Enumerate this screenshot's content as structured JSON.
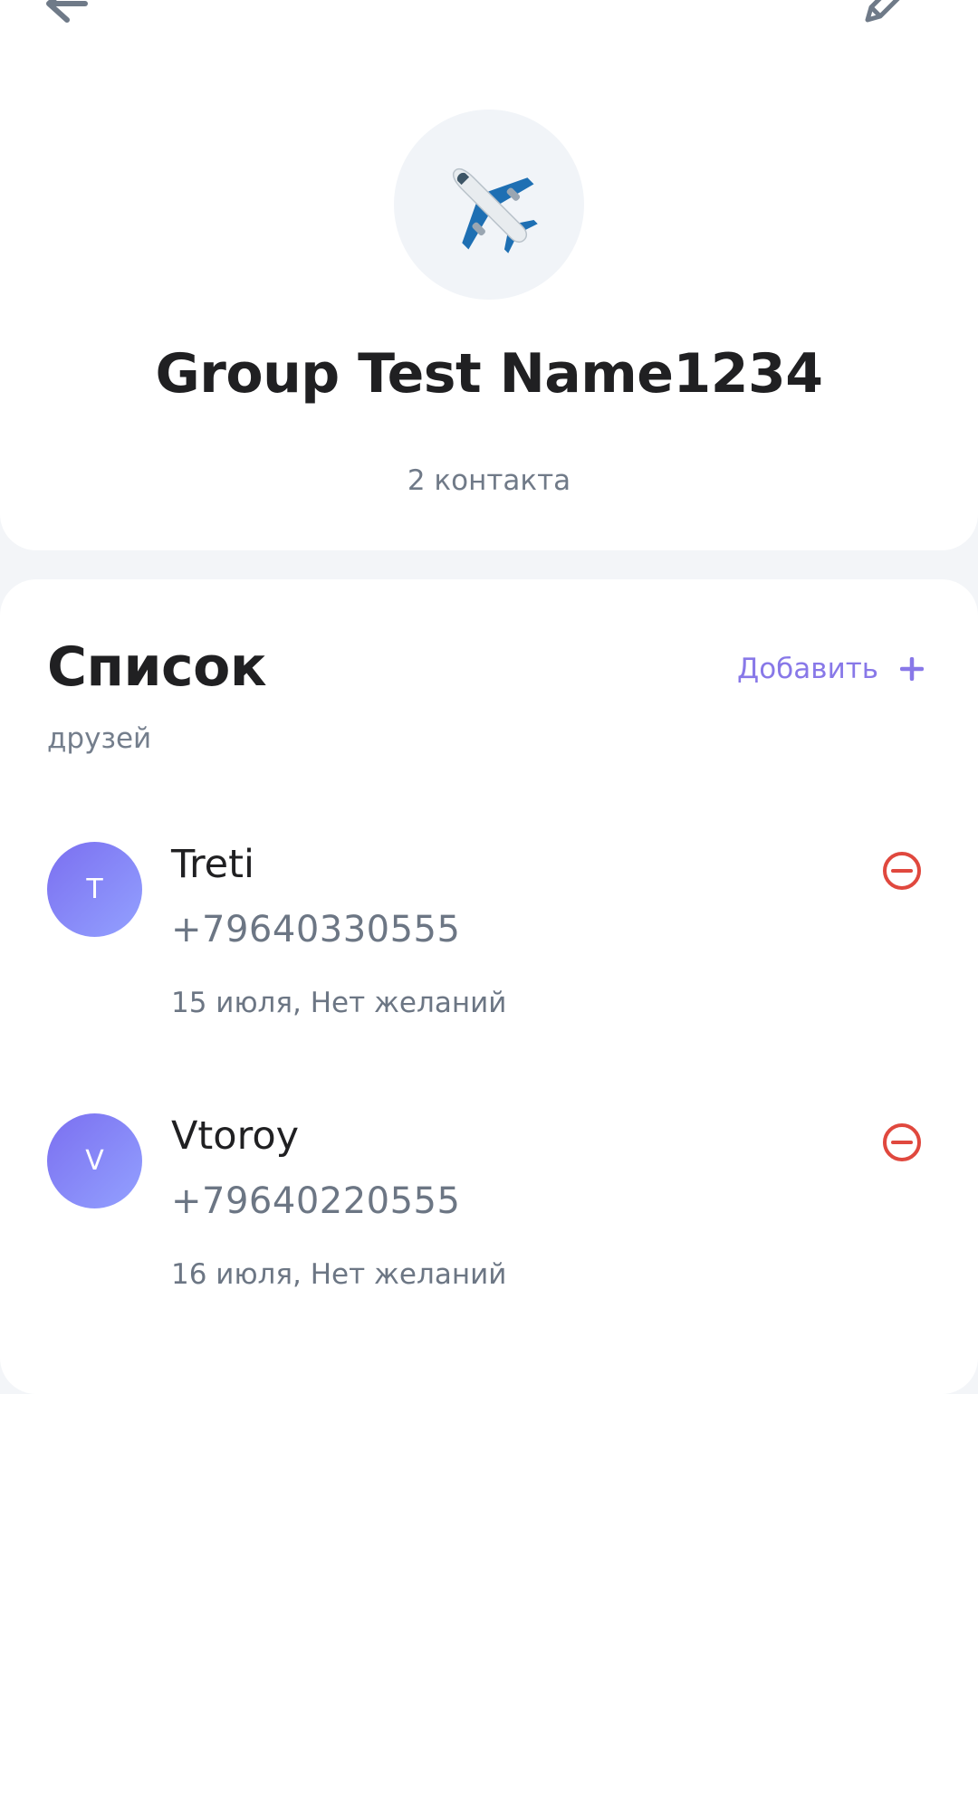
{
  "header": {
    "back_icon": "arrow-left-icon",
    "edit_icon": "pencil-icon",
    "avatar_icon": "airplane-icon",
    "group_name": "Group Test Name1234",
    "contacts_count": "2 контакта"
  },
  "list": {
    "title": "Список",
    "subtitle": "друзей",
    "add_label": "Добавить",
    "add_icon": "plus-icon",
    "contacts": [
      {
        "initial": "T",
        "name": "Treti",
        "phone": "+79640330555",
        "meta": "15 июля, Нет желаний",
        "remove_icon": "minus-circle-icon"
      },
      {
        "initial": "V",
        "name": "Vtoroy",
        "phone": "+79640220555",
        "meta": "16 июля, Нет желаний",
        "remove_icon": "minus-circle-icon"
      }
    ]
  },
  "colors": {
    "accent": "#8878E8",
    "danger": "#E0483E",
    "avatar_gradient_start": "#7B6FF0",
    "avatar_gradient_end": "#93A1FF",
    "background": "#F3F5F8"
  }
}
